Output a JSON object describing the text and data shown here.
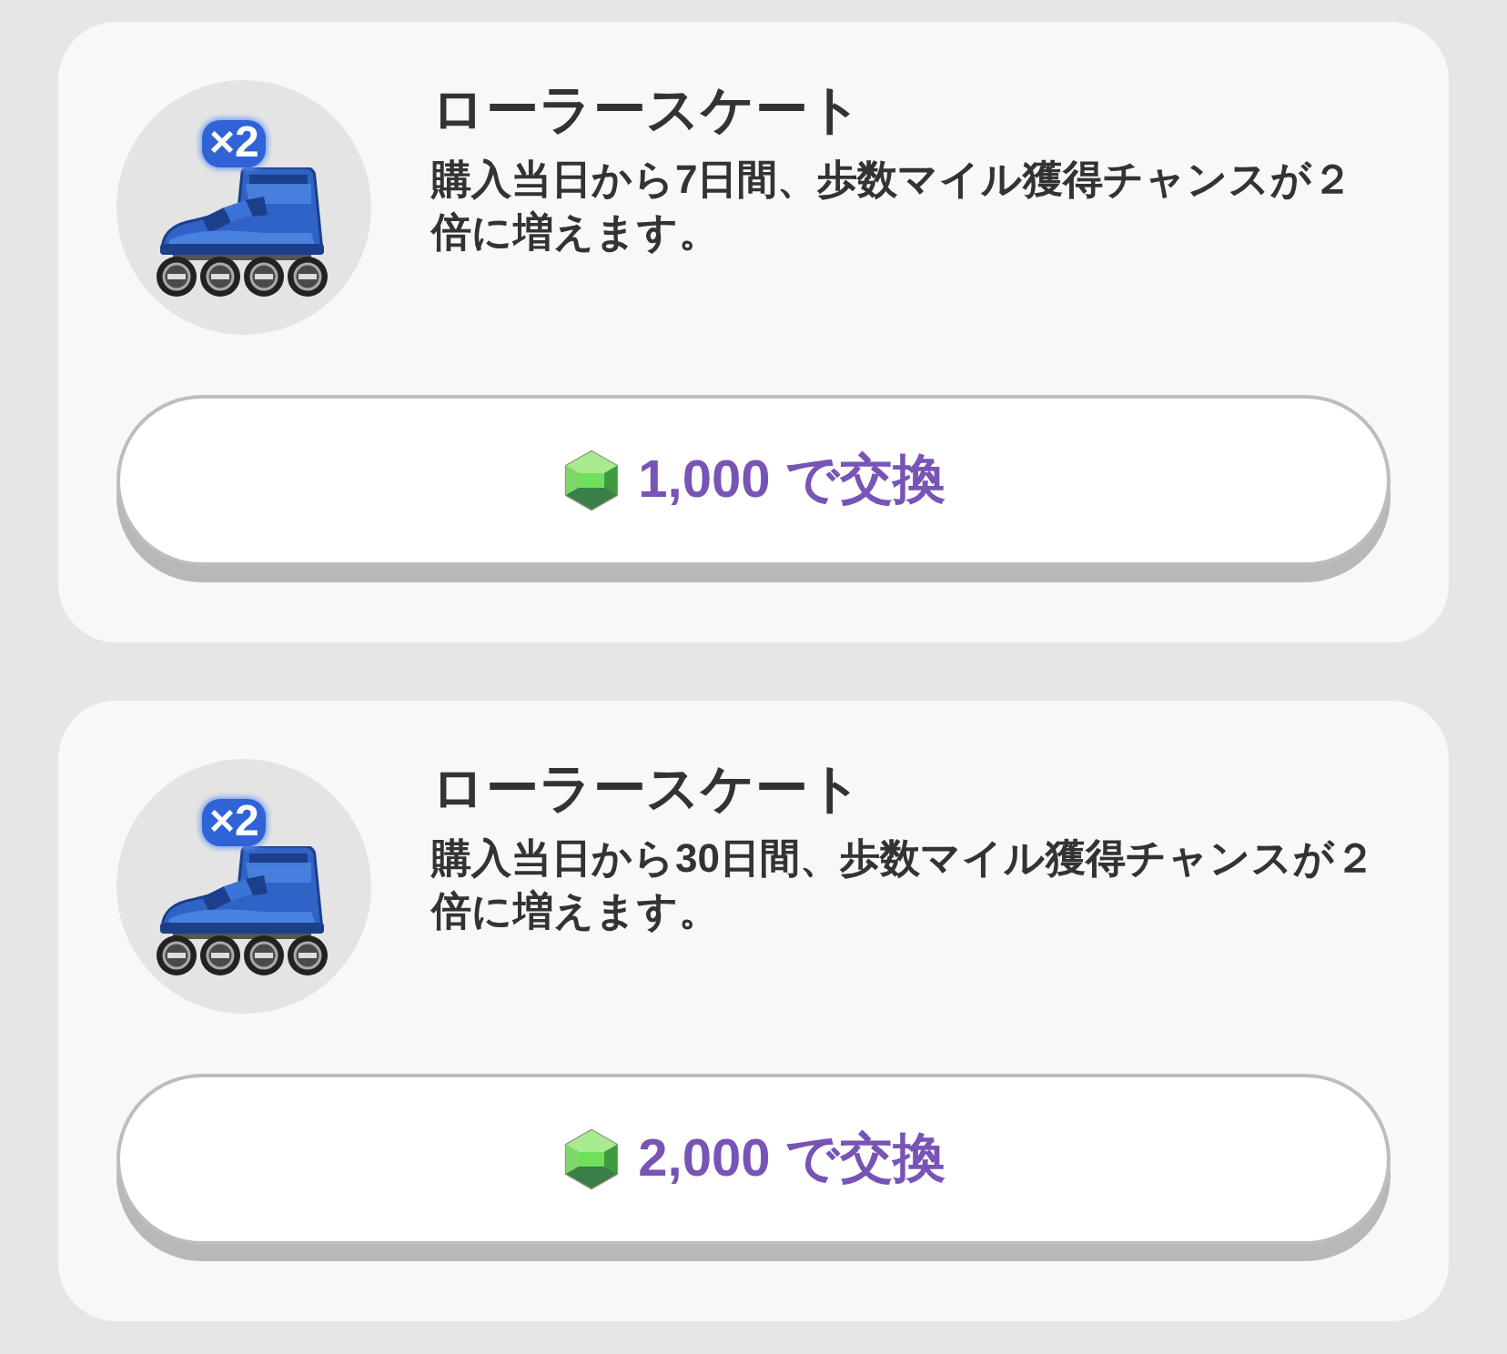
{
  "items": [
    {
      "title": "ローラースケート",
      "description": "購入当日から7日間、歩数マイル獲得チャンスが２倍に増えます。",
      "badge": "×2",
      "button": "1,000 で交換"
    },
    {
      "title": "ローラースケート",
      "description": "購入当日から30日間、歩数マイル獲得チャンスが２倍に増えます。",
      "badge": "×2",
      "button": "2,000 で交換"
    }
  ]
}
